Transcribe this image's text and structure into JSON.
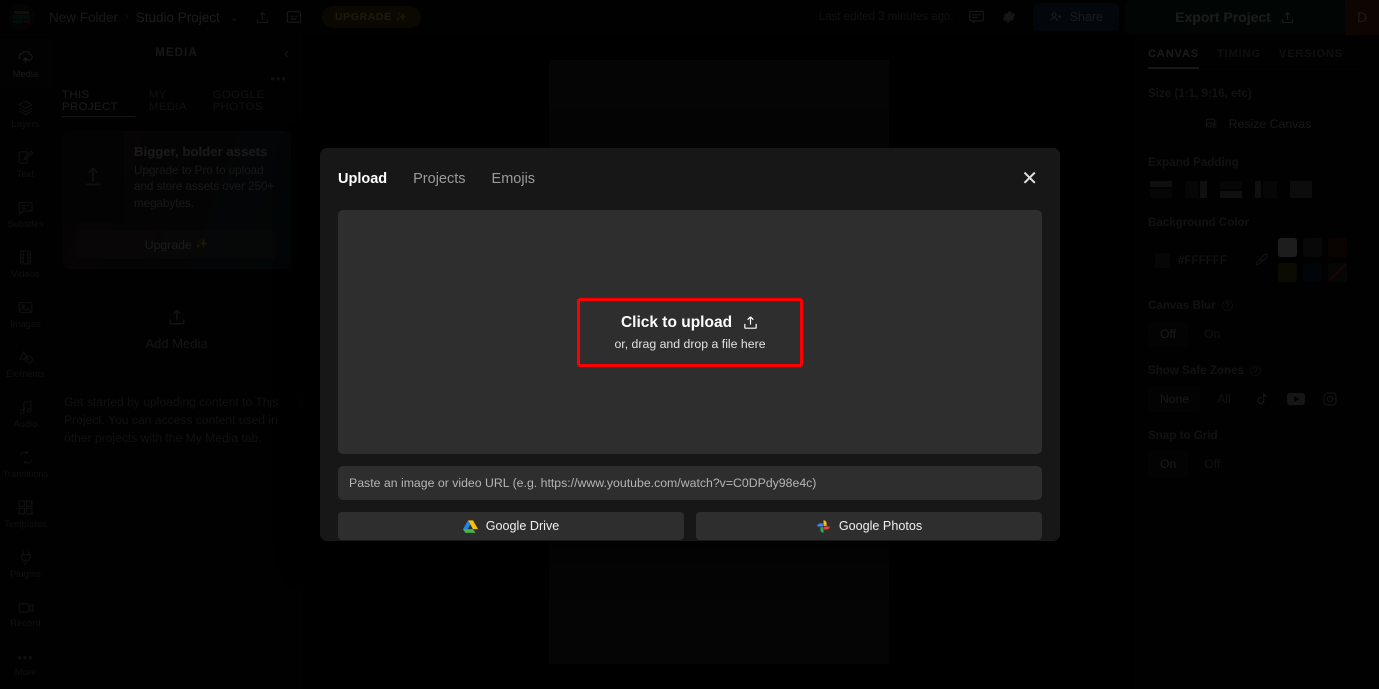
{
  "topbar": {
    "breadcrumb_folder": "New Folder",
    "breadcrumb_sep": "›",
    "breadcrumb_project": "Studio Project",
    "chevron": "⌄",
    "upgrade_label": "UPGRADE",
    "upgrade_sparkle": "✨",
    "last_edited": "Last edited 3 minutes ago.",
    "share_label": "Share",
    "export_label": "Export Project",
    "avatar_initial": "D",
    "icons": {
      "share_upload": "share-upload-icon",
      "captions": "captions-icon",
      "comment": "comment-icon",
      "settings": "gear-icon",
      "add_person": "add-person-icon",
      "export_upload": "export-upload-icon"
    }
  },
  "rail": {
    "items": [
      {
        "label": "Media",
        "icon": "media-upload-icon",
        "active": true
      },
      {
        "label": "Layers",
        "icon": "layers-icon",
        "active": false
      },
      {
        "label": "Text",
        "icon": "text-edit-icon",
        "active": false
      },
      {
        "label": "Subtitles",
        "icon": "subtitles-icon",
        "active": false
      },
      {
        "label": "Videos",
        "icon": "film-icon",
        "active": false
      },
      {
        "label": "Images",
        "icon": "image-icon",
        "active": false
      },
      {
        "label": "Elements",
        "icon": "shapes-icon",
        "active": false
      },
      {
        "label": "Audio",
        "icon": "music-note-icon",
        "active": false
      },
      {
        "label": "Transitions",
        "icon": "transitions-icon",
        "active": false
      },
      {
        "label": "Templates",
        "icon": "grid-icon",
        "active": false
      },
      {
        "label": "Plugins",
        "icon": "plug-icon",
        "active": false
      },
      {
        "label": "Record",
        "icon": "record-camera-icon",
        "active": false
      },
      {
        "label": "More",
        "icon": "ellipsis-icon",
        "active": false
      }
    ]
  },
  "media_panel": {
    "title": "MEDIA",
    "collapse_icon": "chevron-left-icon",
    "overflow_menu": "•••",
    "tabs": [
      {
        "label": "THIS PROJECT",
        "active": true
      },
      {
        "label": "MY MEDIA",
        "active": false
      },
      {
        "label": "GOOGLE PHOTOS",
        "active": false
      }
    ],
    "promo": {
      "title": "Bigger, bolder assets",
      "subtitle": "Upgrade to Pro to upload and store assets over 250+ megabytes.",
      "button_label": "Upgrade",
      "button_sparkle": "✨"
    },
    "add_media_label": "Add Media",
    "hint": "Get started by uploading content to This Project. You can access content used in other projects with the My Media tab."
  },
  "right_panel": {
    "tabs": [
      {
        "label": "CANVAS",
        "active": true
      },
      {
        "label": "TIMING",
        "active": false
      },
      {
        "label": "VERSIONS",
        "active": false
      }
    ],
    "size_label": "Size (1:1, 9:16, etc)",
    "resize_label": "Resize Canvas",
    "expand_padding_label": "Expand Padding",
    "padding_options": [
      "pad-top-icon",
      "pad-left-split-icon",
      "pad-bottom-icon",
      "pad-right-split-icon",
      "pad-all-icon"
    ],
    "background_color_label": "Background Color",
    "background_hex": "#FFFFFF",
    "eyedropper_icon": "eyedropper-icon",
    "swatches": [
      "#ffffff",
      "#4a4a4a",
      "#5c1f16",
      "#6f6309",
      "#12314f",
      "transparent"
    ],
    "canvas_blur_label": "Canvas Blur",
    "canvas_blur_options": [
      {
        "label": "Off",
        "active": true
      },
      {
        "label": "On",
        "active": false
      }
    ],
    "safe_zones_label": "Show Safe Zones",
    "safe_zones_options": [
      {
        "label": "None",
        "active": true
      },
      {
        "label": "All",
        "active": false
      }
    ],
    "safe_zone_platform_icons": [
      "tiktok-icon",
      "youtube-icon",
      "instagram-icon"
    ],
    "snap_grid_label": "Snap to Grid",
    "snap_grid_options": [
      {
        "label": "On",
        "active": true
      },
      {
        "label": "Off",
        "active": false
      }
    ]
  },
  "modal": {
    "tabs": [
      {
        "label": "Upload",
        "active": true
      },
      {
        "label": "Projects",
        "active": false
      },
      {
        "label": "Emojis",
        "active": false
      }
    ],
    "close_icon": "✕",
    "upload_title": "Click to upload",
    "upload_icon": "upload-icon",
    "upload_subtitle": "or, drag and drop a file here",
    "url_placeholder": "Paste an image or video URL (e.g. https://www.youtube.com/watch?v=C0DPdy98e4c)",
    "google_drive_label": "Google Drive",
    "google_photos_label": "Google Photos",
    "highlight_color": "#ff0000"
  }
}
